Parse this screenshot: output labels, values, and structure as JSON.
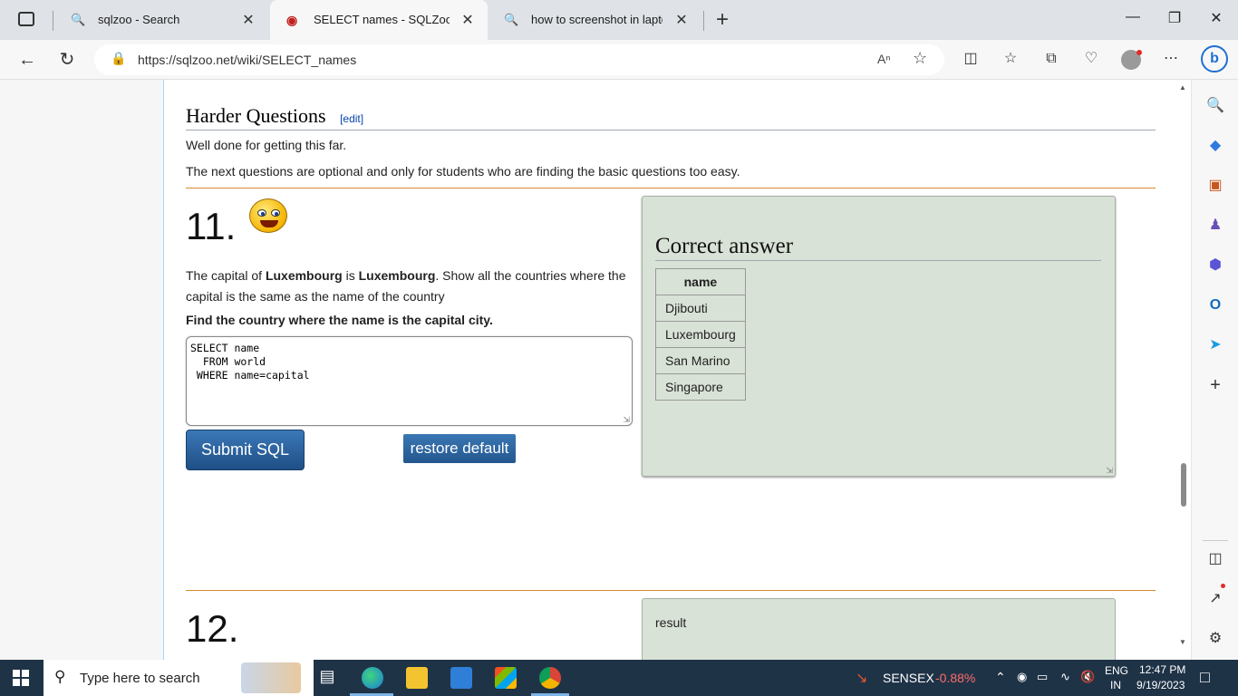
{
  "browser": {
    "tabs": [
      {
        "title": "sqlzoo - Search",
        "icon": "search-icon",
        "active": false
      },
      {
        "title": "SELECT names - SQLZoo",
        "icon": "sqlzoo-icon",
        "active": true
      },
      {
        "title": "how to screenshot in laptop",
        "icon": "search-icon",
        "active": false
      }
    ],
    "new_tab": "+",
    "url": "https://sqlzoo.net/wiki/SELECT_names"
  },
  "page": {
    "section_title": "Harder Questions",
    "edit_label": "[edit]",
    "intro1": "Well done for getting this far.",
    "intro2": "The next questions are optional and only for students who are finding the basic questions too easy.",
    "q11": {
      "number": "11.",
      "text_pre": "The capital of ",
      "bold1": "Luxembourg",
      "text_mid": " is ",
      "bold2": "Luxembourg",
      "text_post": ". Show all the countries where the capital is the same as the name of the country",
      "task": "Find the country where the name is the capital city.",
      "sql": "SELECT name\n  FROM world\n WHERE name=capital",
      "submit_label": "Submit SQL",
      "restore_label": "restore default",
      "answer_title": "Correct answer",
      "answer_header": "name",
      "answer_rows": [
        "Djibouti",
        "Luxembourg",
        "San Marino",
        "Singapore"
      ]
    },
    "q12": {
      "number": "12.",
      "result_label": "result"
    }
  },
  "taskbar": {
    "search_placeholder": "Type here to search",
    "sensex_label": "SENSEX",
    "sensex_change": "-0.88%",
    "lang1": "ENG",
    "lang2": "IN",
    "time": "12:47 PM",
    "date": "9/19/2023"
  },
  "colors": {
    "answer_bg": "#d8e2d6",
    "button_blue": "#2a5f9c",
    "rule_orange": "#d78a2f",
    "sensex_red": "#ff6b6b"
  }
}
